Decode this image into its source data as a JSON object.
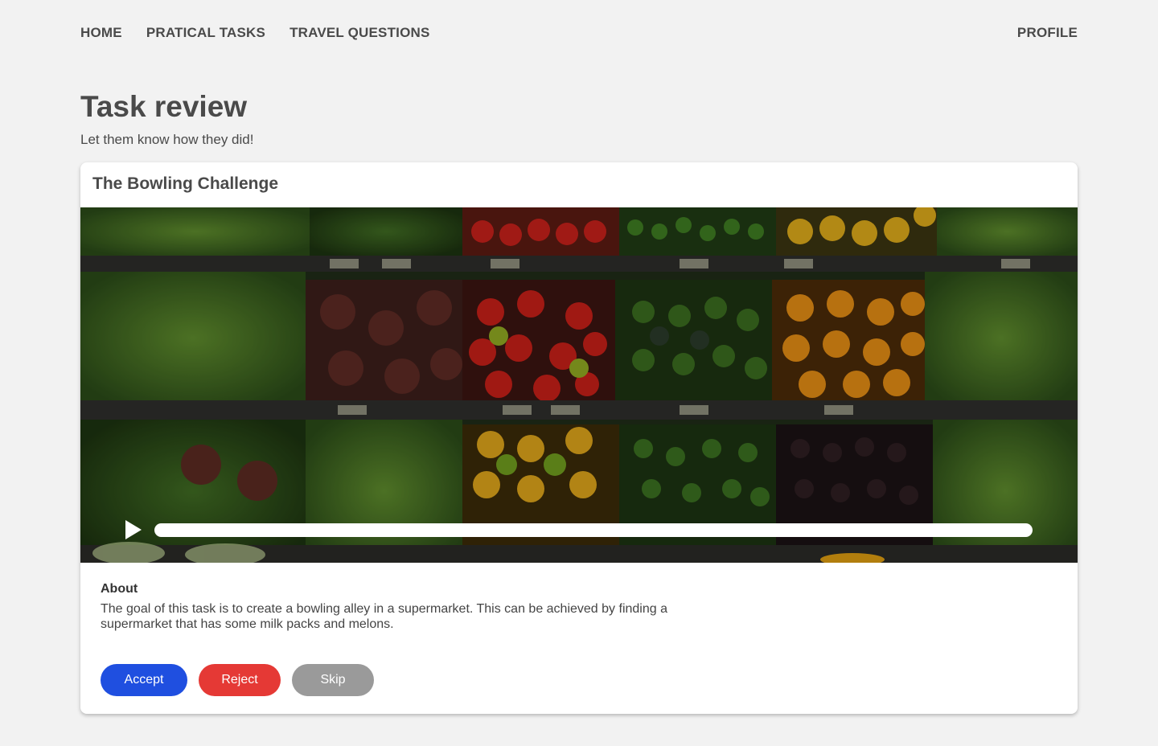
{
  "nav": {
    "items": [
      {
        "label": "HOME"
      },
      {
        "label": "PRATICAL TASKS"
      },
      {
        "label": "TRAVEL QUESTIONS"
      }
    ],
    "profile": "PROFILE"
  },
  "page": {
    "title": "Task review",
    "subtitle": "Let them know how they did!"
  },
  "card": {
    "title": "The Bowling Challenge",
    "video": {
      "thumbnail": "supermarket vegetable shelves",
      "play_icon": "play-icon"
    },
    "about_label": "About",
    "about_text": "The goal of this task is to create a bowling alley in a supermarket. This can be achieved by finding a supermarket that has some milk packs and melons.",
    "buttons": {
      "accept": "Accept",
      "reject": "Reject",
      "skip": "Skip"
    }
  },
  "colors": {
    "accept": "#1f4fe0",
    "reject": "#e53935",
    "skip": "#9a9a9a",
    "background": "#f2f2f2"
  }
}
